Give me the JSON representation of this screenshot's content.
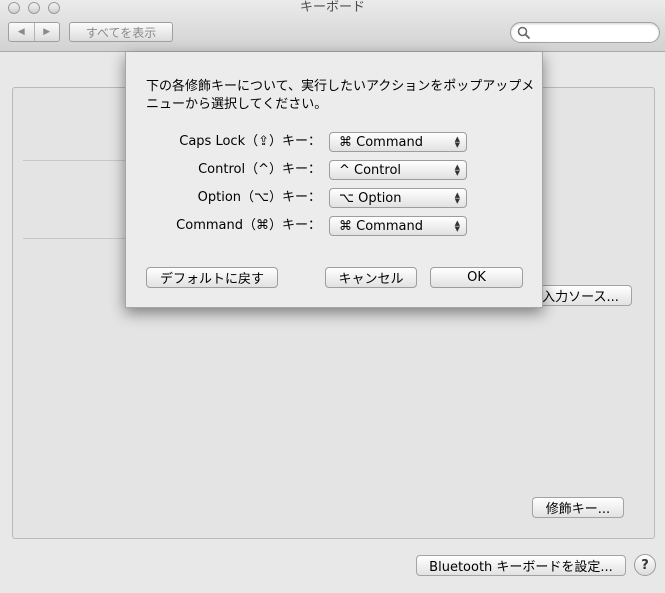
{
  "window": {
    "title": "キーボード"
  },
  "toolbar": {
    "back": "◀",
    "forward": "▶",
    "show_all": "すべてを表示",
    "search_placeholder": ""
  },
  "background": {
    "input_sources_button": "入力ソース...",
    "modifier_keys_button": "修飾キー...",
    "bluetooth_button": "Bluetooth キーボードを設定...",
    "help_button": "?"
  },
  "sheet": {
    "message": "下の各修飾キーについて、実行したいアクションをポップアップメニューから選択してください。",
    "rows": [
      {
        "label": "Caps Lock（⇪）キー：",
        "value": "⌘ Command"
      },
      {
        "label": "Control（^）キー：",
        "value": "^ Control"
      },
      {
        "label": "Option（⌥）キー：",
        "value": "⌥ Option"
      },
      {
        "label": "Command（⌘）キー：",
        "value": "⌘ Command"
      }
    ],
    "default_button": "デフォルトに戻す",
    "cancel_button": "キャンセル",
    "ok_button": "OK"
  }
}
